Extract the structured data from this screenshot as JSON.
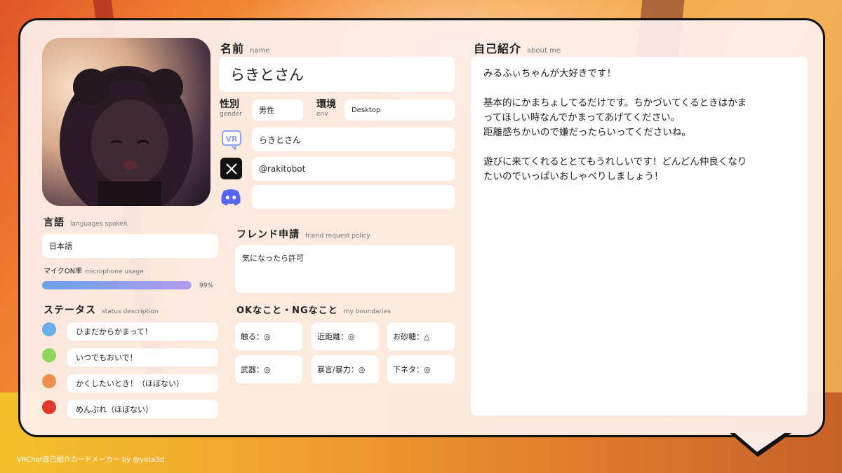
{
  "name": {
    "title": "名前",
    "sub": "name",
    "value": "らきとさん"
  },
  "gender": {
    "title": "性別",
    "sub": "gender",
    "value": "男性"
  },
  "env": {
    "title": "環境",
    "sub": "env",
    "value": "Desktop"
  },
  "social": {
    "vrchat": {
      "icon": "vrchat-icon",
      "value": "らきとさん"
    },
    "x": {
      "icon": "x-icon",
      "value": "@rakitobot"
    },
    "discord": {
      "icon": "discord-icon",
      "value": ""
    }
  },
  "languages": {
    "title": "言語",
    "sub": "languages spoken",
    "value": "日本語"
  },
  "microphone": {
    "title": "マイクON率",
    "sub": "microphone usage",
    "percent": 99,
    "percent_label": "99%"
  },
  "status": {
    "title": "ステータス",
    "sub": "status description",
    "items": [
      {
        "color": "#6aaeea",
        "text": "ひまだからかまって！"
      },
      {
        "color": "#8fd45d",
        "text": "いつでもおいで！"
      },
      {
        "color": "#ec8f4f",
        "text": "かくしたいとき！（ほぼない）"
      },
      {
        "color": "#e2372c",
        "text": "めんぶれ（ほぼない）"
      }
    ]
  },
  "friend_request": {
    "title": "フレンド申請",
    "sub": "friend request policy",
    "value": "気になったら許可"
  },
  "boundaries": {
    "title": "OKなこと・NGなこと",
    "sub": "my boundaries",
    "items": [
      "触る：◎",
      "近距離：◎",
      "お砂糖：△",
      "武器：◎",
      "暴言/暴力：◎",
      "下ネタ：◎"
    ]
  },
  "about": {
    "title": "自己紹介",
    "sub": "about me",
    "lines": [
      "みるふぃちゃんが大好きです！",
      "",
      "基本的にかまちょしてるだけです。ちかづいてくるときはかま",
      "ってほしい時なんでかまってあげてください。",
      "距離感ちかいので嫌だったらいってくださいね。",
      "",
      "遊びに来てくれるととてもうれしいです！どんどん仲良くなり",
      "たいのでいっぱいおしゃべりしましょう！"
    ]
  },
  "footer": "VRChat自己紹介カードメーカー by @yota3d",
  "colors": {
    "bar_start": "#6aa0ee",
    "bar_end": "#b39cf2",
    "x_bg": "#111111",
    "discord": "#5865f2",
    "vrchat_border": "#8fa0f0"
  }
}
